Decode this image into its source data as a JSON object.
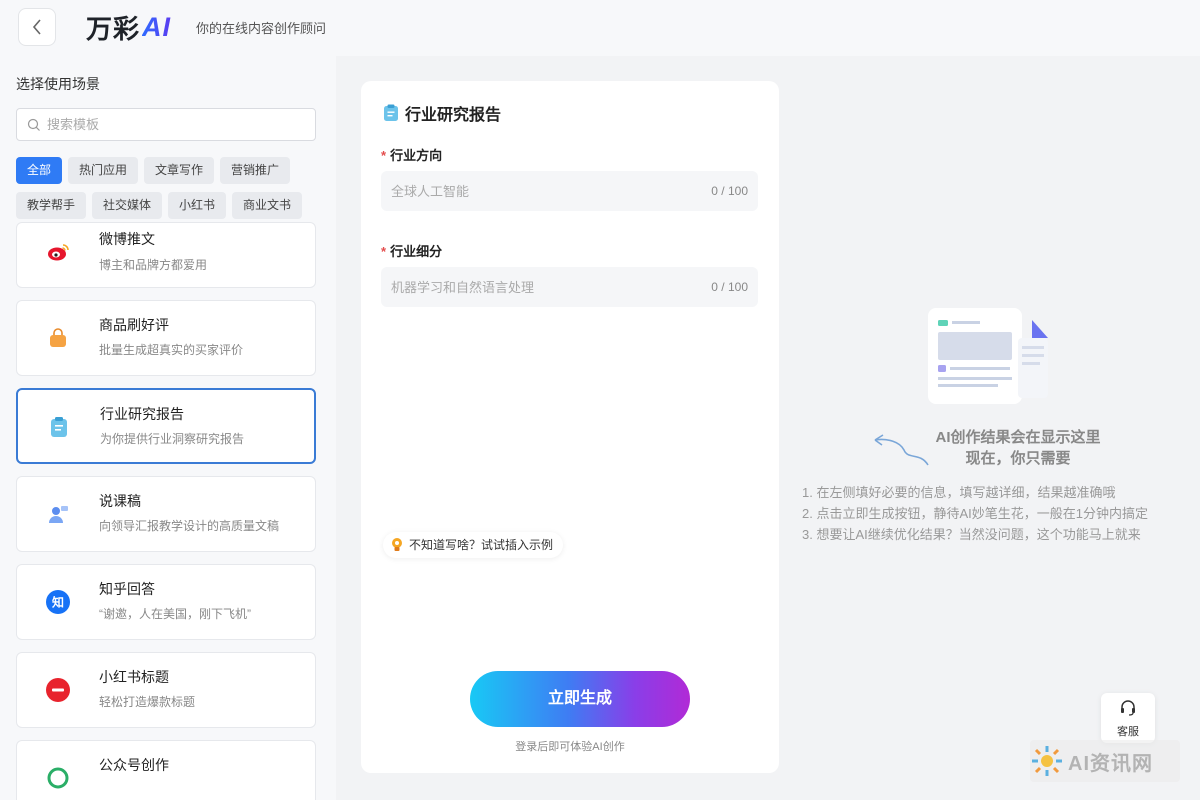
{
  "header": {
    "logo_text": "万彩",
    "logo_ai": "AI",
    "slogan": "你的在线内容创作顾问"
  },
  "sidebar": {
    "section_title": "选择使用场景",
    "search_placeholder": "搜索模板",
    "filters": [
      {
        "label": "全部",
        "active": true
      },
      {
        "label": "热门应用",
        "active": false
      },
      {
        "label": "文章写作",
        "active": false
      },
      {
        "label": "营销推广",
        "active": false
      },
      {
        "label": "教学帮手",
        "active": false
      },
      {
        "label": "社交媒体",
        "active": false
      },
      {
        "label": "小红书",
        "active": false
      },
      {
        "label": "商业文书",
        "active": false
      }
    ],
    "templates": [
      {
        "title": "微博推文",
        "desc": "博主和品牌方都爱用",
        "icon": "weibo-icon"
      },
      {
        "title": "商品刷好评",
        "desc": "批量生成超真实的买家评价",
        "icon": "shopping-bag-icon"
      },
      {
        "title": "行业研究报告",
        "desc": "为你提供行业洞察研究报告",
        "icon": "clipboard-report-icon",
        "selected": true
      },
      {
        "title": "说课稿",
        "desc": "向领导汇报教学设计的高质量文稿",
        "icon": "teacher-icon"
      },
      {
        "title": "知乎回答",
        "desc": "“谢邀，人在美国，刚下飞机”",
        "icon": "zhihu-icon"
      },
      {
        "title": "小红书标题",
        "desc": "轻松打造爆款标题",
        "icon": "xiaohongshu-icon"
      },
      {
        "title": "公众号创作",
        "desc": "",
        "icon": "wechat-icon"
      }
    ]
  },
  "form": {
    "title": "行业研究报告",
    "field1": {
      "required_mark": "*",
      "label": "行业方向",
      "placeholder": "全球人工智能",
      "count": "0 / 100"
    },
    "field2": {
      "required_mark": "*",
      "label": "行业细分",
      "placeholder": "机器学习和自然语言处理",
      "count": "0 / 100"
    },
    "example_hint": "不知道写啥？试试插入示例",
    "generate_label": "立即生成",
    "login_hint": "登录后即可体验AI创作"
  },
  "result": {
    "title_line1": "AI创作结果会在显示这里",
    "title_line2": "现在，你只需要",
    "steps": [
      "1. 在左侧填好必要的信息，填写越详细，结果越准确哦",
      "2. 点击立即生成按钮，静待AI妙笔生花，一般在1分钟内搞定",
      "3. 想要让AI继续优化结果？当然没问题，这个功能马上就来"
    ]
  },
  "service": {
    "label": "客服"
  },
  "watermark": {
    "text": "AI资讯网"
  },
  "colors": {
    "accent": "#2f7bf5",
    "required": "#e34d4d",
    "selected_border": "#3a7bd5"
  }
}
